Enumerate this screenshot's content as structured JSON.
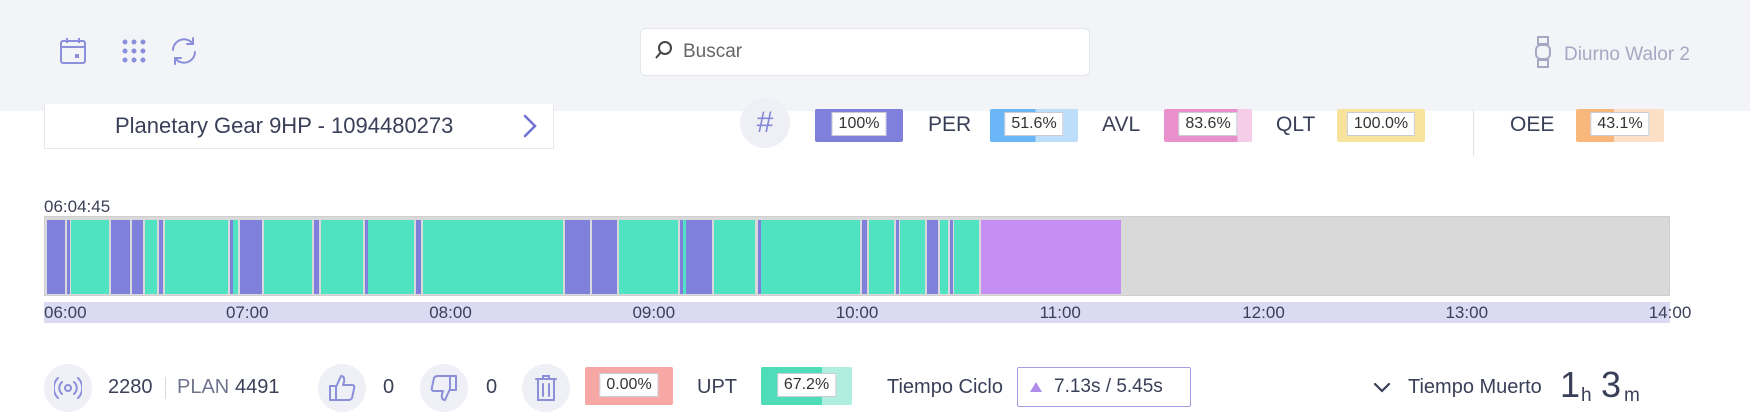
{
  "header": {
    "icons": [
      "calendar-icon",
      "grid-icon",
      "refresh-icon"
    ],
    "search_placeholder": "Buscar",
    "user_name": "Diurno Walor 2"
  },
  "product": {
    "name": "Planetary Gear 9HP - 1094480273"
  },
  "metrics": {
    "hash_symbol": "#",
    "hash_value": "100%",
    "per_label": "PER",
    "per_value": "51.6%",
    "per_fraction": 0.516,
    "avl_label": "AVL",
    "avl_value": "83.6%",
    "avl_fraction": 0.836,
    "qlt_label": "QLT",
    "qlt_value": "100.0%",
    "qlt_fraction": 1.0,
    "oee_label": "OEE",
    "oee_value": "43.1%",
    "oee_fraction": 0.431
  },
  "colors": {
    "running": "#4fe3c2",
    "stopped": "#7f7fdc",
    "other": "#c48ef3",
    "empty": "#d9d9d9",
    "hash_pill": "#7f7fdc",
    "per_pill": "#6ab6f7",
    "avl_pill": "#e98fcb",
    "qlt_pill": "#f8e39c",
    "oee_pill": "#f9b77b",
    "rejects": "#f7a7a4",
    "upt": "#4fdcb8"
  },
  "timeline": {
    "start_label": "06:04:45",
    "axis_start_hour": 6,
    "axis_end_hour": 14,
    "ticks": [
      "06:00",
      "07:00",
      "08:00",
      "09:00",
      "10:00",
      "11:00",
      "12:00",
      "13:00",
      "14:00"
    ],
    "segments": [
      {
        "start": "06:00",
        "end": "06:06",
        "state": "stopped"
      },
      {
        "start": "06:06",
        "end": "06:07",
        "state": "stopped"
      },
      {
        "start": "06:07",
        "end": "06:19",
        "state": "running"
      },
      {
        "start": "06:19",
        "end": "06:25",
        "state": "stopped"
      },
      {
        "start": "06:25",
        "end": "06:29",
        "state": "stopped"
      },
      {
        "start": "06:29",
        "end": "06:33",
        "state": "running"
      },
      {
        "start": "06:33",
        "end": "06:35",
        "state": "stopped"
      },
      {
        "start": "06:35",
        "end": "06:54",
        "state": "running"
      },
      {
        "start": "06:54",
        "end": "06:55",
        "state": "stopped"
      },
      {
        "start": "06:55",
        "end": "06:57",
        "state": "running"
      },
      {
        "start": "06:57",
        "end": "07:04",
        "state": "stopped"
      },
      {
        "start": "07:04",
        "end": "07:19",
        "state": "running"
      },
      {
        "start": "07:19",
        "end": "07:21",
        "state": "stopped"
      },
      {
        "start": "07:21",
        "end": "07:34",
        "state": "running"
      },
      {
        "start": "07:34",
        "end": "07:35",
        "state": "stopped"
      },
      {
        "start": "07:35",
        "end": "07:49",
        "state": "running"
      },
      {
        "start": "07:49",
        "end": "07:51",
        "state": "stopped"
      },
      {
        "start": "07:51",
        "end": "08:33",
        "state": "running"
      },
      {
        "start": "08:33",
        "end": "08:41",
        "state": "stopped"
      },
      {
        "start": "08:41",
        "end": "08:49",
        "state": "stopped"
      },
      {
        "start": "08:49",
        "end": "09:07",
        "state": "running"
      },
      {
        "start": "09:07",
        "end": "09:08",
        "state": "stopped"
      },
      {
        "start": "09:08",
        "end": "09:09",
        "state": "running"
      },
      {
        "start": "09:09",
        "end": "09:17",
        "state": "stopped"
      },
      {
        "start": "09:17",
        "end": "09:30",
        "state": "running"
      },
      {
        "start": "09:30",
        "end": "09:31",
        "state": "stopped"
      },
      {
        "start": "09:31",
        "end": "10:01",
        "state": "running"
      },
      {
        "start": "10:01",
        "end": "10:03",
        "state": "stopped"
      },
      {
        "start": "10:03",
        "end": "10:11",
        "state": "running"
      },
      {
        "start": "10:11",
        "end": "10:12",
        "state": "stopped"
      },
      {
        "start": "10:12",
        "end": "10:20",
        "state": "running"
      },
      {
        "start": "10:20",
        "end": "10:24",
        "state": "stopped"
      },
      {
        "start": "10:24",
        "end": "10:27",
        "state": "running"
      },
      {
        "start": "10:27",
        "end": "10:28",
        "state": "stopped"
      },
      {
        "start": "10:28",
        "end": "10:36",
        "state": "running"
      },
      {
        "start": "10:36",
        "end": "11:18",
        "state": "other"
      }
    ]
  },
  "stats": {
    "produced": "2280",
    "plan_label": "PLAN",
    "plan_value": "4491",
    "good": "0",
    "bad": "0",
    "rejects_value": "0.00%",
    "upt_label": "UPT",
    "upt_value": "67.2%",
    "upt_fraction": 0.672,
    "ciclo_label": "Tiempo Ciclo",
    "ciclo_value": "7.13s / 5.45s",
    "muerto_label": "Tiempo Muerto",
    "muerto_hours": "1",
    "muerto_hours_unit": "h",
    "muerto_minutes": "3",
    "muerto_minutes_unit": "m"
  }
}
